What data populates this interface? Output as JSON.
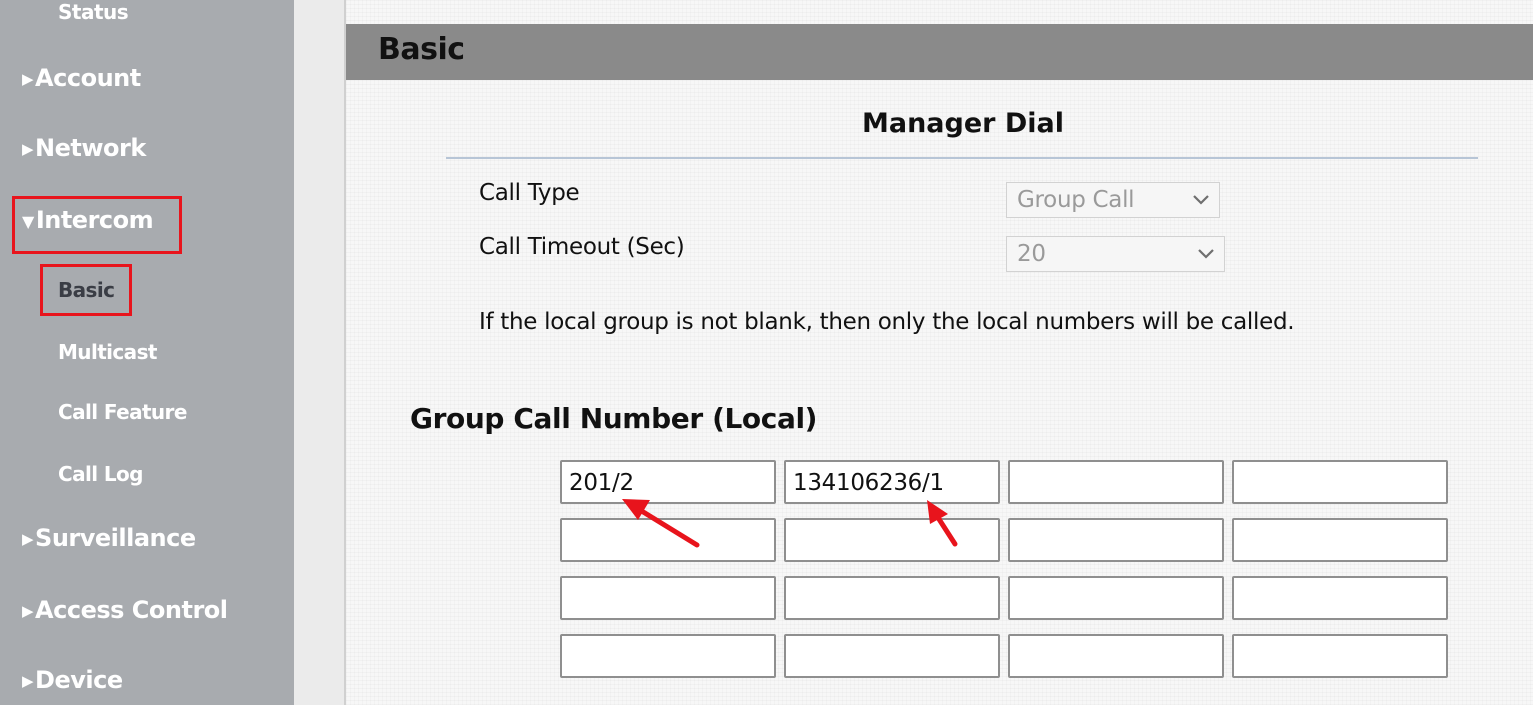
{
  "sidebar": {
    "status": "Status",
    "items": [
      {
        "label": "Account",
        "expanded": false
      },
      {
        "label": "Network",
        "expanded": false
      },
      {
        "label": "Intercom",
        "expanded": true,
        "children": [
          "Basic",
          "Multicast",
          "Call Feature",
          "Call Log"
        ],
        "active_child": "Basic"
      },
      {
        "label": "Surveillance",
        "expanded": false
      },
      {
        "label": "Access Control",
        "expanded": false
      },
      {
        "label": "Device",
        "expanded": false
      }
    ],
    "icons": {
      "collapsed": "triangle-right-icon",
      "expanded": "triangle-down-icon"
    }
  },
  "page": {
    "title": "Basic"
  },
  "manager_dial": {
    "title": "Manager Dial",
    "call_type_label": "Call Type",
    "call_type_value": "Group Call",
    "call_timeout_label": "Call Timeout (Sec)",
    "call_timeout_value": "20",
    "note": "If the local group is not blank, then only the local numbers will be called."
  },
  "group_call": {
    "title": "Group Call Number (Local)",
    "rows": [
      [
        "201/2",
        "134106236/1",
        "",
        ""
      ],
      [
        "",
        "",
        "",
        ""
      ],
      [
        "",
        "",
        "",
        ""
      ],
      [
        "",
        "",
        "",
        ""
      ]
    ]
  },
  "colors": {
    "sidebar_bg": "#a8abaf",
    "header_bg": "#8a8a8a",
    "highlight": "#e8141c",
    "active_text": "#3a3d45"
  }
}
